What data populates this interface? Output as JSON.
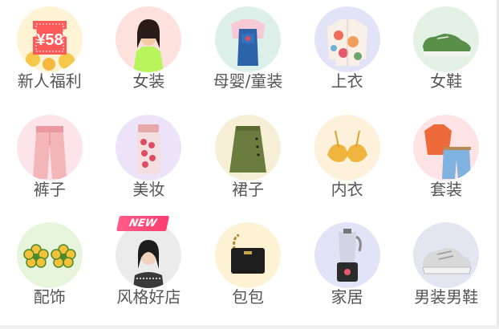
{
  "categories": [
    {
      "label": "新人福利",
      "icon": "coupon-icon",
      "bg": "#fff3d6",
      "badge_text": "¥58"
    },
    {
      "label": "女装",
      "icon": "womens-clothing-icon",
      "bg": "#fde1dd"
    },
    {
      "label": "母婴/童装",
      "icon": "kids-clothing-icon",
      "bg": "#dcefe9"
    },
    {
      "label": "上衣",
      "icon": "shirt-icon",
      "bg": "#e3e3f7"
    },
    {
      "label": "女鞋",
      "icon": "womens-shoe-icon",
      "bg": "#e3f2e4"
    },
    {
      "label": "裤子",
      "icon": "pants-icon",
      "bg": "#fde4ea"
    },
    {
      "label": "美妆",
      "icon": "cosmetics-icon",
      "bg": "#ece3f9"
    },
    {
      "label": "裙子",
      "icon": "skirt-icon",
      "bg": "#f6efd5"
    },
    {
      "label": "内衣",
      "icon": "bra-icon",
      "bg": "#fdf1dc"
    },
    {
      "label": "套装",
      "icon": "outfit-icon",
      "bg": "#fde3e3"
    },
    {
      "label": "配饰",
      "icon": "accessory-icon",
      "bg": "#e6f5dc"
    },
    {
      "label": "风格好店",
      "icon": "style-store-icon",
      "bg": "#ebebeb",
      "new_badge": "NEW"
    },
    {
      "label": "包包",
      "icon": "bag-icon",
      "bg": "#fdf2d3"
    },
    {
      "label": "家居",
      "icon": "home-appliance-icon",
      "bg": "#e2e3f7"
    },
    {
      "label": "男装男鞋",
      "icon": "mens-shoe-icon",
      "bg": "#e5e5f2"
    }
  ]
}
